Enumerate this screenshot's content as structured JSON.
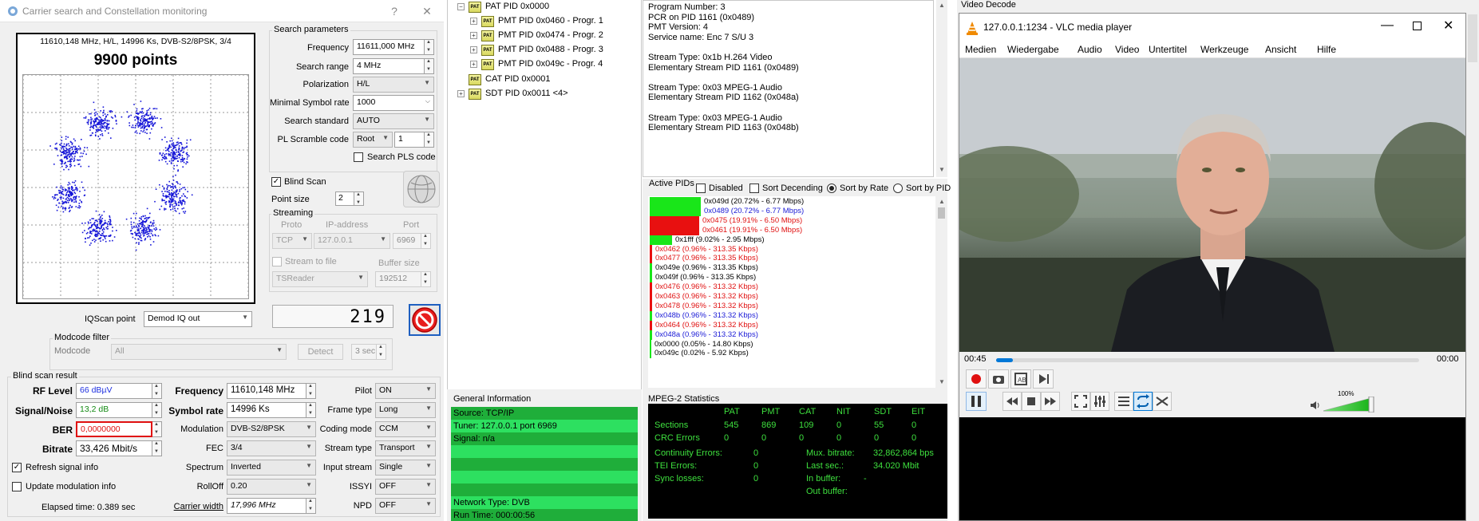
{
  "window1": {
    "title": "Carrier search and Constellation monitoring",
    "help_btn": "?",
    "close_btn": "✕"
  },
  "constellation": {
    "header": "11610,148 MHz, H/L, 14996 Ks, DVB-S2/8PSK, 3/4",
    "points": "9900 points"
  },
  "search": {
    "group": "Search parameters",
    "frequency_label": "Frequency",
    "frequency": "11611,000 MHz",
    "range_label": "Search range",
    "range": "4 MHz",
    "polarization_label": "Polarization",
    "polarization": "H/L",
    "msr_label": "Minimal Symbol rate",
    "msr": "1000",
    "standard_label": "Search standard",
    "standard": "AUTO",
    "pls_label": "PL Scramble code",
    "pls_mode": "Root",
    "pls_value": "1",
    "search_pls": "Search PLS code",
    "blind_scan": "Blind Scan",
    "point_size_label": "Point size",
    "point_size": "2",
    "streaming": "Streaming",
    "proto_label": "Proto",
    "ip_label": "IP-address",
    "port_label": "Port",
    "proto": "TCP",
    "ip": "127.0.0.1",
    "port": "6969",
    "stream_to_file": "Stream to file",
    "buffer_label": "Buffer size",
    "file_type": "TSReader",
    "buffer": "192512",
    "counter": "219"
  },
  "iq": {
    "label": "IQScan point",
    "value": "Demod IQ out",
    "modcode_group": "Modcode filter",
    "modcode_label": "Modcode",
    "modcode_value": "All",
    "detect": "Detect",
    "detect_time": "3 sec"
  },
  "result": {
    "group": "Blind scan result",
    "rf_label": "RF Level",
    "rf": "66 dBµV",
    "sn_label": "Signal/Noise",
    "sn": "13,2 dB",
    "ber_label": "BER",
    "ber": "0,0000000",
    "bitrate_label": "Bitrate",
    "bitrate": "33,426 Mbit/s",
    "freq_label": "Frequency",
    "freq": "11610,148 MHz",
    "sr_label": "Symbol rate",
    "sr": "14996 Ks",
    "mod_label": "Modulation",
    "mod": "DVB-S2/8PSK",
    "fec_label": "FEC",
    "fec": "3/4",
    "spectrum_label": "Spectrum",
    "spectrum": "Inverted",
    "rolloff_label": "RollOff",
    "rolloff": "0.20",
    "cw_label": "Carrier width",
    "cw": "17,996 MHz",
    "pilot_label": "Pilot",
    "pilot": "ON",
    "frame_label": "Frame type",
    "frame": "Long",
    "coding_label": "Coding mode",
    "coding": "CCM",
    "stream_label": "Stream type",
    "stream": "Transport",
    "input_label": "Input stream",
    "input": "Single",
    "issyi_label": "ISSYI",
    "issyi": "OFF",
    "npd_label": "NPD",
    "npd": "OFF",
    "refresh": "Refresh signal info",
    "update_mod": "Update modulation info",
    "elapsed": "Elapsed time: 0.389 sec"
  },
  "tree": {
    "pat": "PAT PID 0x0000",
    "pmts": [
      "PMT PID 0x0460 - Progr. 1",
      "PMT PID 0x0474 - Progr. 2",
      "PMT PID 0x0488 - Progr. 3",
      "PMT PID 0x049c - Progr. 4"
    ],
    "cat": "CAT PID 0x0001",
    "sdt": "SDT PID 0x0011 <4>",
    "icon_label": "PAT"
  },
  "info_lines": [
    "Program Number: 3",
    "PCR on PID 1161 (0x0489)",
    "PMT Version: 4",
    "Service name: Enc 7 S/U 3",
    "",
    "Stream Type: 0x1b H.264 Video",
    " Elementary Stream PID 1161 (0x0489)",
    "",
    "Stream Type: 0x03 MPEG-1 Audio",
    " Elementary Stream PID 1162 (0x048a)",
    "",
    "Stream Type: 0x03 MPEG-1 Audio",
    " Elementary Stream PID 1163 (0x048b)"
  ],
  "pids": {
    "title": "Active PIDs",
    "disabled": "Disabled",
    "sort_desc": "Sort Decending",
    "sort_rate": "Sort by Rate",
    "sort_pid": "Sort by PID",
    "rows": [
      {
        "t": "0x049d (20.72% - 6.77 Mbps)",
        "c": "#000",
        "bar": "#19e619",
        "share": 0.2072
      },
      {
        "t": "0x0489 (20.72% - 6.77 Mbps)",
        "c": "#1a1ad6",
        "bar": "#19e619",
        "share": 0.2072
      },
      {
        "t": "0x0475 (19.91% - 6.50 Mbps)",
        "c": "#e01010",
        "bar": "#e81010",
        "share": 0.1991
      },
      {
        "t": "0x0461 (19.91% - 6.50 Mbps)",
        "c": "#e01010",
        "bar": "#e81010",
        "share": 0.1991
      },
      {
        "t": "0x1fff (9.02% - 2.95 Mbps)",
        "c": "#000",
        "bar": "#19e619",
        "share": 0.0902
      },
      {
        "t": "0x0462 (0.96% - 313.35 Kbps)",
        "c": "#e01010",
        "bar": "#e81010",
        "share": 0.0096
      },
      {
        "t": "0x0477 (0.96% - 313.35 Kbps)",
        "c": "#e01010",
        "bar": "#e81010",
        "share": 0.0096
      },
      {
        "t": "0x049e (0.96% - 313.35 Kbps)",
        "c": "#000",
        "bar": "#19e619",
        "share": 0.0096
      },
      {
        "t": "0x049f (0.96% - 313.35 Kbps)",
        "c": "#000",
        "bar": "#19e619",
        "share": 0.0096
      },
      {
        "t": "0x0476 (0.96% - 313.32 Kbps)",
        "c": "#e01010",
        "bar": "#e81010",
        "share": 0.0096
      },
      {
        "t": "0x0463 (0.96% - 313.32 Kbps)",
        "c": "#e01010",
        "bar": "#e81010",
        "share": 0.0096
      },
      {
        "t": "0x0478 (0.96% - 313.32 Kbps)",
        "c": "#e01010",
        "bar": "#e81010",
        "share": 0.0096
      },
      {
        "t": "0x048b (0.96% - 313.32 Kbps)",
        "c": "#1a1ad6",
        "bar": "#19e619",
        "share": 0.0096
      },
      {
        "t": "0x0464 (0.96% - 313.32 Kbps)",
        "c": "#e01010",
        "bar": "#e81010",
        "share": 0.0096
      },
      {
        "t": "0x048a (0.96% - 313.32 Kbps)",
        "c": "#1a1ad6",
        "bar": "#19e619",
        "share": 0.0096
      },
      {
        "t": "0x0000 (0.05% - 14.80 Kbps)",
        "c": "#000",
        "bar": "#19e619",
        "share": 0.0005
      },
      {
        "t": "0x049c (0.02% - 5.92 Kbps)",
        "c": "#000",
        "bar": "#19e619",
        "share": 0.0002
      }
    ]
  },
  "general": {
    "title": "General Information",
    "rows": [
      "Source: TCP/IP",
      "Tuner: 127.0.0.1 port 6969",
      "Signal: n/a",
      "",
      "",
      "",
      "",
      "Network Type: DVB",
      "Run Time: 000:00:56"
    ]
  },
  "mpeg": {
    "title": "MPEG-2 Statistics",
    "headers": [
      "PAT",
      "PMT",
      "CAT",
      "NIT",
      "SDT",
      "EIT"
    ],
    "sections_label": "Sections",
    "sections": [
      "545",
      "869",
      "109",
      "0",
      "55",
      "0"
    ],
    "crc_label": "CRC Errors",
    "crc": [
      "0",
      "0",
      "0",
      "0",
      "0",
      "0"
    ],
    "cont_label": "Continuity Errors:",
    "cont": "0",
    "tei_label": "TEI Errors:",
    "tei": "0",
    "sync_label": "Sync losses:",
    "sync": "0",
    "mux_label": "Mux. bitrate:",
    "mux": "32,862,864 bps",
    "last_label": "Last sec.:",
    "last": "34.020 Mbit",
    "inbuf_label": "In buffer:",
    "inbuf": "-",
    "outbuf_label": "Out buffer:"
  },
  "vlc": {
    "pane_title": "Video Decode",
    "title": "127.0.0.1:1234 - VLC media player",
    "menu": [
      "Medien",
      "Wiedergabe",
      "Audio",
      "Video",
      "Untertitel",
      "Werkzeuge",
      "Ansicht",
      "Hilfe"
    ],
    "time_elapsed": "00:45",
    "time_total": "00:00",
    "volume": "100%",
    "progress": 0.04,
    "volume_level": 1.0
  },
  "colors": {
    "accent": "#0078d7",
    "green": "#19e619",
    "red": "#e81010",
    "mpeg_text": "#3ee03e"
  }
}
